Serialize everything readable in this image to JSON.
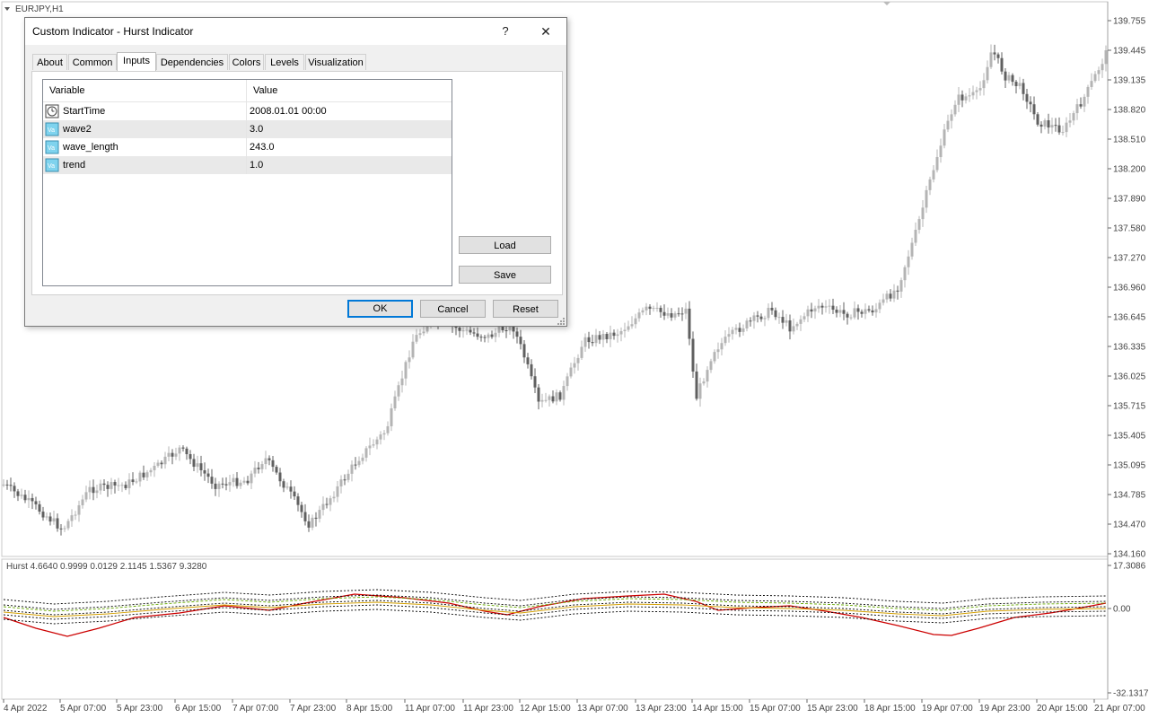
{
  "chart": {
    "symbol_label": "EURJPY,H1",
    "price_axis": [
      "139.755",
      "139.445",
      "139.135",
      "138.820",
      "138.510",
      "138.200",
      "137.890",
      "137.580",
      "137.270",
      "136.960",
      "136.645",
      "136.335",
      "136.025",
      "135.715",
      "135.405",
      "135.095",
      "134.785",
      "134.470",
      "134.160"
    ],
    "time_axis": [
      "4 Apr 2022",
      "5 Apr 07:00",
      "5 Apr 23:00",
      "6 Apr 15:00",
      "7 Apr 07:00",
      "7 Apr 23:00",
      "8 Apr 15:00",
      "11 Apr 07:00",
      "11 Apr 23:00",
      "12 Apr 15:00",
      "13 Apr 07:00",
      "13 Apr 23:00",
      "14 Apr 15:00",
      "15 Apr 07:00",
      "15 Apr 23:00",
      "18 Apr 15:00",
      "19 Apr 07:00",
      "19 Apr 23:00",
      "20 Apr 15:00",
      "21 Apr 07:00"
    ],
    "indicator_label": "Hurst 4.6640 0.9999 0.0129 2.1145 1.5367 9.3280",
    "indicator_axis": [
      "17.3086",
      "0.00",
      "-32.1317"
    ],
    "colors": {
      "up_candle": "#b4b4b4",
      "down_candle": "#606060",
      "hurst_line": "#cc0000",
      "band_line": "#000000",
      "green_line": "#66aa00",
      "yellow_line": "#d4a000",
      "grid": "#c8c8c8"
    }
  },
  "dialog": {
    "title": "Custom Indicator - Hurst Indicator",
    "help_label": "?",
    "close_label": "✕",
    "tabs": [
      "About",
      "Common",
      "Inputs",
      "Dependencies",
      "Colors",
      "Levels",
      "Visualization"
    ],
    "active_tab": "Inputs",
    "table": {
      "headers": [
        "Variable",
        "Value"
      ],
      "rows": [
        {
          "icon": "datetime-icon",
          "variable": "StartTime",
          "value": "2008.01.01 00:00"
        },
        {
          "icon": "variable-icon",
          "variable": "wave2",
          "value": "3.0"
        },
        {
          "icon": "variable-icon",
          "variable": "wave_length",
          "value": "243.0"
        },
        {
          "icon": "variable-icon",
          "variable": "trend",
          "value": "1.0"
        }
      ]
    },
    "buttons": {
      "load": "Load",
      "save": "Save",
      "ok": "OK",
      "cancel": "Cancel",
      "reset": "Reset"
    }
  }
}
